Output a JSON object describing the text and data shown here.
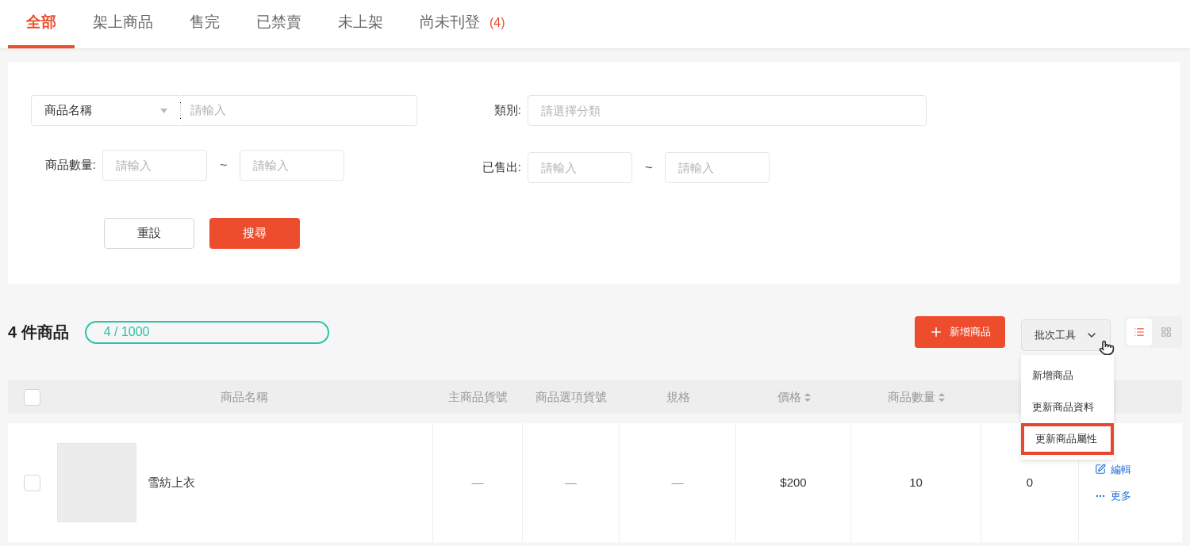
{
  "tabs": [
    {
      "label": "全部",
      "selected": true
    },
    {
      "label": "架上商品",
      "selected": false
    },
    {
      "label": "售完",
      "selected": false
    },
    {
      "label": "已禁賣",
      "selected": false
    },
    {
      "label": "未上架",
      "selected": false
    },
    {
      "label": "尚未刊登",
      "count": "(4)",
      "selected": false
    }
  ],
  "filters": {
    "name_select": {
      "value": "商品名稱",
      "placeholder": "請輸入"
    },
    "category": {
      "label": "類別:",
      "placeholder": "請選擇分類"
    },
    "quantity": {
      "label": "商品數量:",
      "from_placeholder": "請輸入",
      "separator": "~",
      "to_placeholder": "請輸入"
    },
    "sold": {
      "label": "已售出:",
      "from_placeholder": "請輸入",
      "separator": "~",
      "to_placeholder": "請輸入"
    },
    "buttons": [
      {
        "label": "重設",
        "kind": "secondary"
      },
      {
        "label": "搜尋",
        "kind": "primary"
      }
    ]
  },
  "summary": {
    "title": "4 件商品",
    "usage": "4 / 1000"
  },
  "toolbar": {
    "add_button": "新增商品",
    "batch_button": "批次工具",
    "view_modes": [
      {
        "kind": "list",
        "selected": true
      },
      {
        "kind": "grid",
        "selected": false
      }
    ]
  },
  "batch_menu": [
    {
      "label": "新增商品",
      "highlighted": false
    },
    {
      "label": "更新商品資料",
      "highlighted": false
    },
    {
      "label": "更新商品屬性",
      "highlighted": true
    }
  ],
  "table": {
    "header_checked": false,
    "columns": [
      {
        "label": "商品名稱",
        "sortable": false
      },
      {
        "label": "主商品貨號",
        "sortable": false
      },
      {
        "label": "商品選項貨號",
        "sortable": false
      },
      {
        "label": "規格",
        "sortable": false
      },
      {
        "label": "價格",
        "sortable": true
      },
      {
        "label": "商品數量",
        "sortable": true
      }
    ],
    "rows": [
      {
        "checked": false,
        "name": "雪紡上衣",
        "main_sku": "—",
        "option_sku": "—",
        "variation": "—",
        "price": "$200",
        "stock": "10",
        "sold": "0",
        "actions": [
          {
            "kind": "edit",
            "label": "編輯"
          },
          {
            "kind": "more",
            "label": "更多"
          }
        ]
      }
    ]
  }
}
